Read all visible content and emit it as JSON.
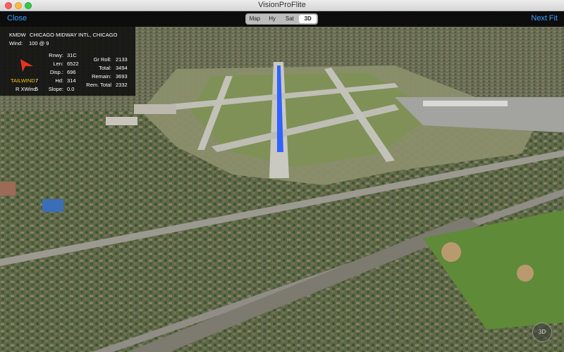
{
  "window": {
    "title": "VisionProFlite"
  },
  "toolbar": {
    "close_label": "Close",
    "next_label": "Next",
    "fit_label": "Fit",
    "view_modes": [
      "Map",
      "Hy",
      "Sat",
      "3D"
    ],
    "active_view": "3D"
  },
  "panel": {
    "airport_code": "KMDW",
    "airport_name": "CHICAGO MIDWAY INTL, CHICAGO",
    "wind_label": "Wind:",
    "wind_value": "100 @ 9",
    "tailwind_label": "TAILWIND",
    "tailwind_value": "7",
    "rxwind_label": "R XWind",
    "rxwind_value": "5",
    "left_stats": [
      {
        "label": "Rnwy:",
        "value": "31C"
      },
      {
        "label": "Len:",
        "value": "6522"
      },
      {
        "label": "Disp.:",
        "value": "696"
      },
      {
        "label": "Hd:",
        "value": "314"
      },
      {
        "label": "Slope:",
        "value": "0.0"
      }
    ],
    "right_stats": [
      {
        "label": "Gr Roll:",
        "value": "2133"
      },
      {
        "label": "Total:",
        "value": "3494"
      },
      {
        "label": "Remain:",
        "value": "3693"
      },
      {
        "label": "Rem. Total",
        "value": "2332"
      }
    ],
    "wind_arrow_icon": "wind-direction-arrow-icon",
    "accent_color": "#f5c518",
    "arrow_color": "#e8321c"
  },
  "map": {
    "runway_highlight_color": "#2f63ff",
    "badge_label": "3D"
  }
}
